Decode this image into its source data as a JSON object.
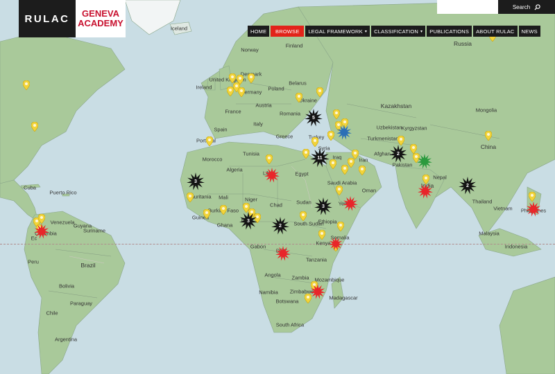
{
  "brand": {
    "logo_text": "RULAC",
    "partner_line1": "GENEVA",
    "partner_line2": "ACADEMY"
  },
  "search": {
    "placeholder": "",
    "button_label": "Search",
    "icon": "search-icon"
  },
  "nav": [
    {
      "label": "HOME",
      "active": false,
      "dropdown": false
    },
    {
      "label": "BROWSE",
      "active": true,
      "dropdown": false
    },
    {
      "label": "LEGAL FRAMEWORK",
      "active": false,
      "dropdown": true
    },
    {
      "label": "CLASSIFICATION",
      "active": false,
      "dropdown": true
    },
    {
      "label": "PUBLICATIONS",
      "active": false,
      "dropdown": false
    },
    {
      "label": "ABOUT RULAC",
      "active": false,
      "dropdown": false
    },
    {
      "label": "NEWS",
      "active": false,
      "dropdown": false
    }
  ],
  "colors": {
    "nav_bg": "#1c1c1c",
    "active": "#e2231a",
    "pin": "#f2d43a",
    "burst_red": "#e8262a",
    "burst_black": "#141414",
    "burst_blue": "#2b6fb6",
    "burst_green": "#2c9a3e",
    "water": "#c9dde4",
    "land": "#a9c99a"
  },
  "labels": {
    "iceland": "Iceland",
    "finland": "Finland",
    "norway": "Norway",
    "russia": "Russia",
    "uk": "United Kingdom",
    "ireland": "Ireland",
    "denmark": "Denmark",
    "germany": "Germany",
    "poland": "Poland",
    "belarus": "Belarus",
    "france": "France",
    "austria": "Austria",
    "ukraine": "Ukraine",
    "kazakhstan": "Kazakhstan",
    "mongolia": "Mongolia",
    "romania": "Romania",
    "italy": "Italy",
    "spain": "Spain",
    "portugal": "Portugal",
    "greece": "Greece",
    "turkey": "Turkey",
    "uzbekistan": "Uzbekistan",
    "kyrgyzstan": "Kyrgyzstan",
    "turkmenistan": "Turkmenistan",
    "china": "China",
    "tunisia": "Tunisia",
    "morocco": "Morocco",
    "syria": "Syria",
    "iraq": "Iraq",
    "iran": "Iran",
    "afghanistan": "Afghan",
    "pakistan": "Pakistan",
    "nepal": "Nepal",
    "algeria": "Algeria",
    "libya": "Libya",
    "egypt": "Egypt",
    "saudi": "Saudi Arabia",
    "oman": "Oman",
    "india": "India",
    "cuba": "Cuba",
    "puerto_rico": "Puerto Rico",
    "mauritania": "Mauritania",
    "mali": "Mali",
    "niger": "Niger",
    "chad": "Chad",
    "sudan": "Sudan",
    "yemen": "Yem",
    "thailand": "Thailand",
    "vietnam": "Vietnam",
    "philippines": "Philippines",
    "burkina": "Burkina Faso",
    "guinea": "Guinea",
    "ghana": "Ghana",
    "ni": "Ni",
    "south_sudan": "South Sudan",
    "ethiopia": "Ethiopia",
    "somalia": "Somalia",
    "malaysia": "Malaysia",
    "venezuela": "Venezuela",
    "guyana": "Guyana",
    "suriname": "Suriname",
    "colombia": "Colombia",
    "gabon": "Gabon",
    "drc": "DRC",
    "kenya": "Kenya",
    "tanzania": "Tanzania",
    "indonesia": "Indonesia",
    "peru": "Peru",
    "brazil": "Brazil",
    "bolivia": "Bolivia",
    "angola": "Angola",
    "zambia": "Zambia",
    "mozambique": "Mozambique",
    "namibia": "Namibia",
    "zimbabwe": "Zimbabwe",
    "botswana": "Botswana",
    "madagascar": "Madagascar",
    "paraguay": "Paraguay",
    "chile": "Chile",
    "south_africa": "South Africa",
    "argentina": "Argentina",
    "ecuador": "Ec",
    "senegal": "",
    "sweden": ""
  },
  "conflict_counts": {
    "ukraine_black": "5",
    "mauritania_black": "3",
    "syria_black": "11",
    "afghan_black": "2",
    "nigeria_black": "3",
    "ethiopia_black": "3",
    "south_sudan_black": "2",
    "myanmar_black": "2"
  }
}
